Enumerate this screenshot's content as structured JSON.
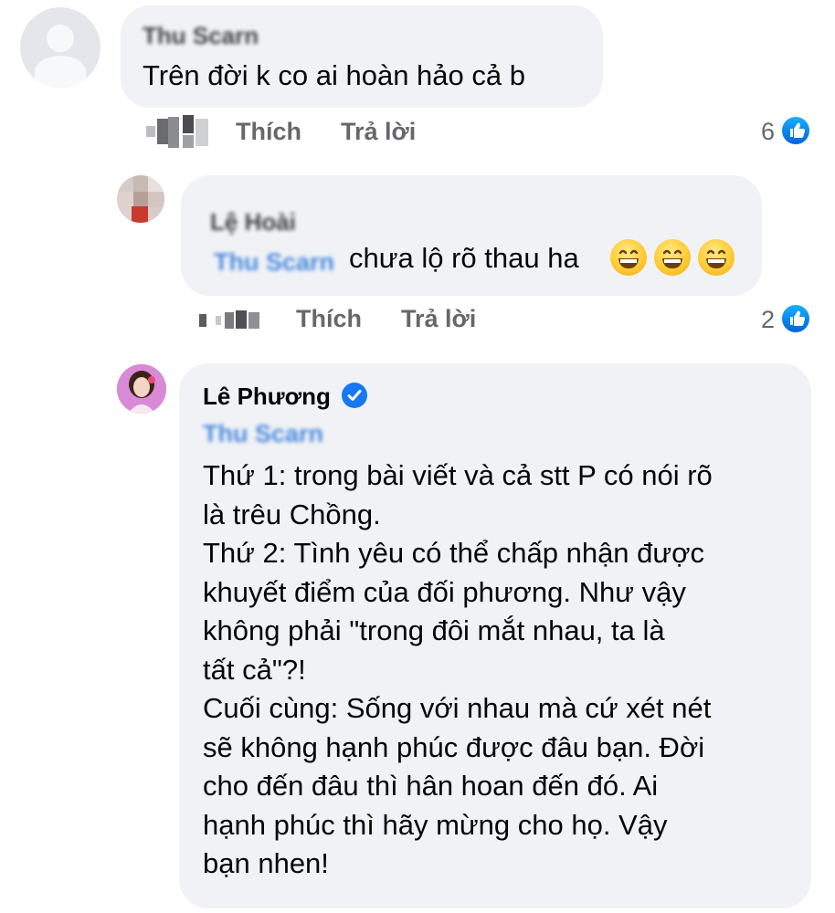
{
  "comments": [
    {
      "author": "Thu Scarn",
      "text": "Trên đời k co ai hoàn hảo cả b",
      "time": "",
      "like_label": "Thích",
      "reply_label": "Trả lời",
      "reaction_count": "6"
    },
    {
      "author": "Lệ Hoài",
      "mention": "Thu Scarn",
      "text": "chưa lộ rõ thau ha",
      "emojis": [
        "grinning-face-icon",
        "grinning-face-icon",
        "grinning-face-icon"
      ],
      "time": "",
      "like_label": "Thích",
      "reply_label": "Trả lời",
      "reaction_count": "2"
    },
    {
      "author": "Lê Phương",
      "verified": true,
      "mention": "Thu Scarn",
      "lines": [
        "Thứ 1: trong bài viết và cả stt P có nói rõ",
        "là trêu Chồng.",
        "Thứ 2: Tình yêu có thể chấp nhận được",
        "khuyết điểm của đối phương. Như vậy",
        "không phải \"trong đôi mắt nhau, ta là",
        "tất cả\"?!",
        "Cuối cùng: Sống với nhau mà cứ xét nét",
        "sẽ không hạnh phúc được đâu bạn. Đời",
        "cho đến đâu thì hân hoan đến đó. Ai",
        "hạnh phúc thì hãy mừng cho họ. Vậy",
        "bạn nhen!"
      ]
    }
  ],
  "colors": {
    "bubble": "#f0f2f5",
    "text": "#050505",
    "secondary": "#65676b",
    "link": "#216fdb",
    "like_blue": "#1877f2"
  }
}
